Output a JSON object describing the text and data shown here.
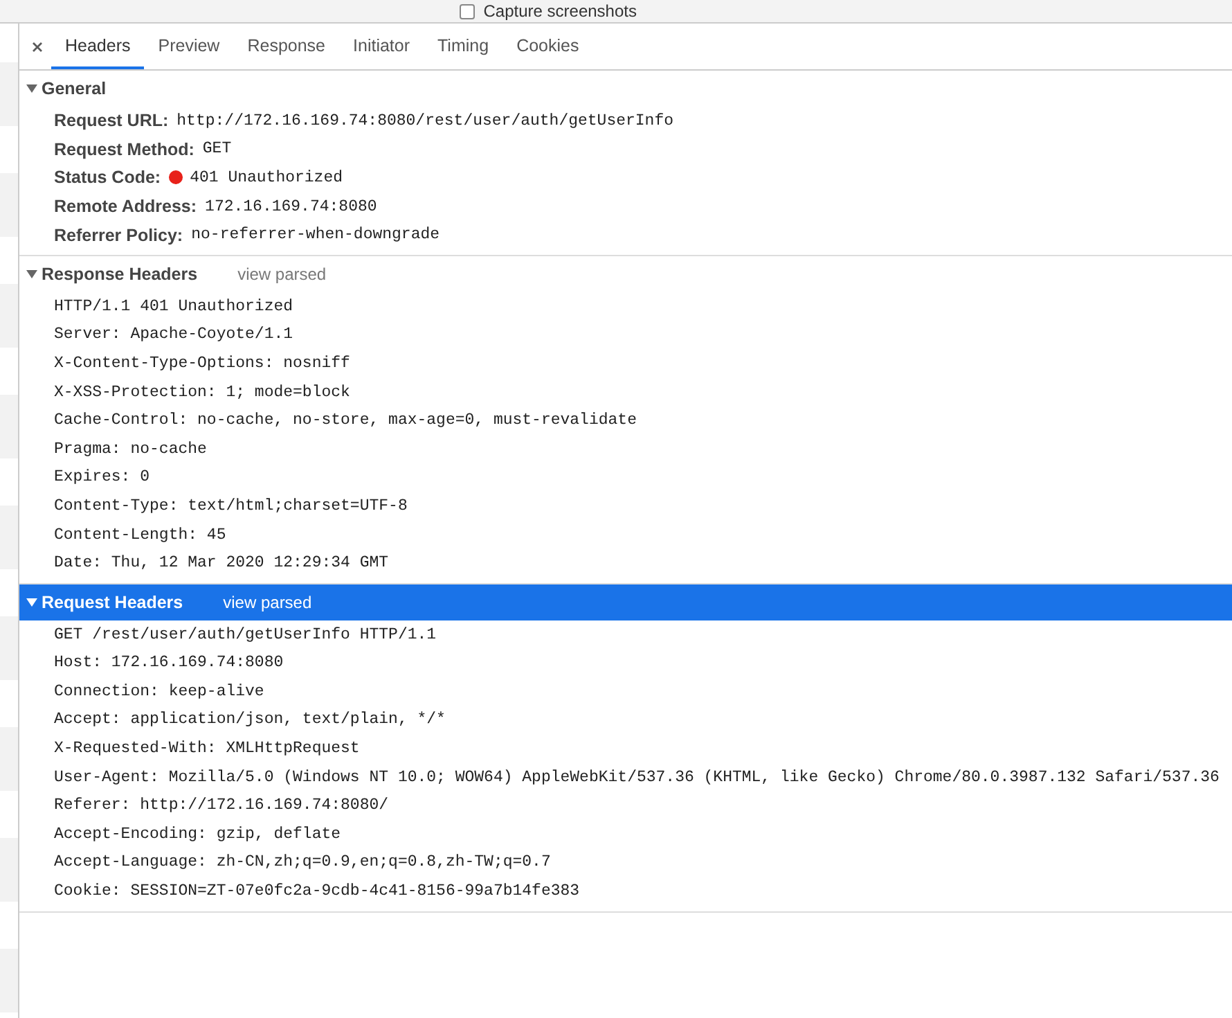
{
  "toolbar": {
    "capture_screenshots": {
      "label": "Capture screenshots",
      "checked": false
    }
  },
  "tabs": [
    {
      "label": "Headers",
      "selected": true
    },
    {
      "label": "Preview",
      "selected": false
    },
    {
      "label": "Response",
      "selected": false
    },
    {
      "label": "Initiator",
      "selected": false
    },
    {
      "label": "Timing",
      "selected": false
    },
    {
      "label": "Cookies",
      "selected": false
    }
  ],
  "sections": [
    {
      "title": "General",
      "expanded": true,
      "selected": false,
      "rows": [
        {
          "name": "Request URL:",
          "value": "http://172.16.169.74:8080/rest/user/auth/getUserInfo"
        },
        {
          "name": "Request Method:",
          "value": "GET"
        },
        {
          "name": "Status Code:",
          "value": "401 Unauthorized",
          "color": "#e8211a"
        },
        {
          "name": "Remote Address:",
          "value": "172.16.169.74:8080"
        },
        {
          "name": "Referrer Policy:",
          "value": "no-referrer-when-downgrade"
        }
      ]
    },
    {
      "title": "Response Headers",
      "link": "view parsed",
      "expanded": true,
      "selected": false,
      "lines": [
        "HTTP/1.1 401 Unauthorized",
        "Server: Apache-Coyote/1.1",
        "X-Content-Type-Options: nosniff",
        "X-XSS-Protection: 1; mode=block",
        "Cache-Control: no-cache, no-store, max-age=0, must-revalidate",
        "Pragma: no-cache",
        "Expires: 0",
        "Content-Type: text/html;charset=UTF-8",
        "Content-Length: 45",
        "Date: Thu, 12 Mar 2020 12:29:34 GMT"
      ]
    },
    {
      "title": "Request Headers",
      "link": "view parsed",
      "expanded": true,
      "selected": true,
      "lines": [
        "GET /rest/user/auth/getUserInfo HTTP/1.1",
        "Host: 172.16.169.74:8080",
        "Connection: keep-alive",
        "Accept: application/json, text/plain, */*",
        "X-Requested-With: XMLHttpRequest",
        "User-Agent: Mozilla/5.0 (Windows NT 10.0; WOW64) AppleWebKit/537.36 (KHTML, like Gecko) Chrome/80.0.3987.132 Safari/537.36",
        "Referer: http://172.16.169.74:8080/",
        "Accept-Encoding: gzip, deflate",
        "Accept-Language: zh-CN,zh;q=0.9,en;q=0.8,zh-TW;q=0.7",
        "Cookie: SESSION=ZT-07e0fc2a-9cdb-4c41-8156-99a7b14fe383"
      ]
    }
  ]
}
